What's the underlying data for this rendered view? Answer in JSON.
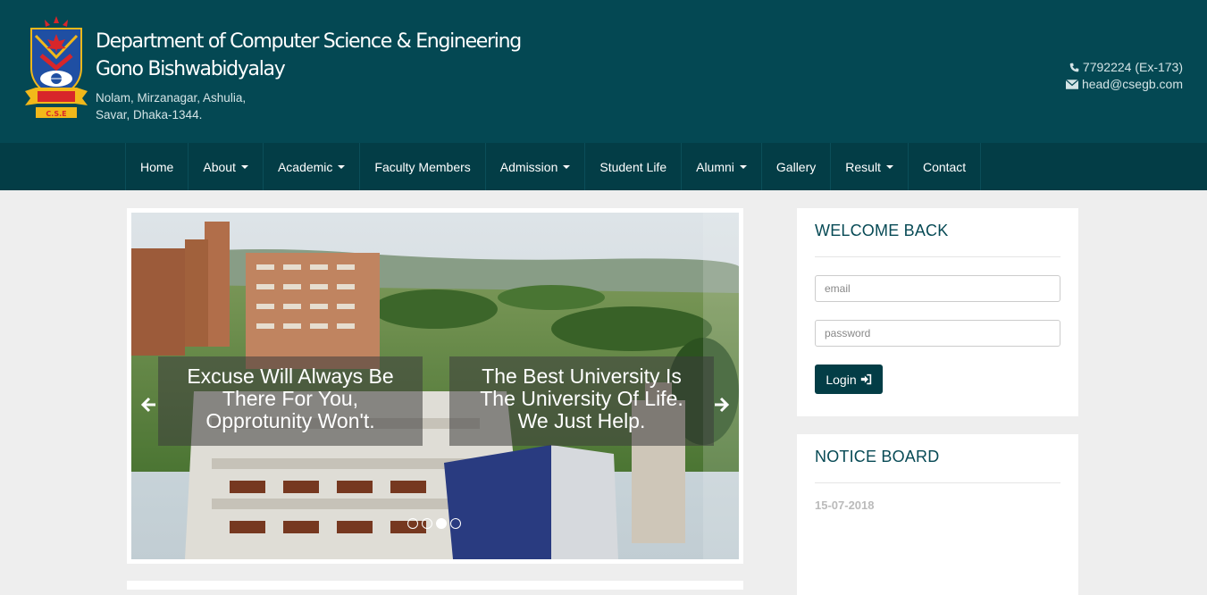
{
  "header": {
    "title_line1": "Department of Computer Science & Engineering",
    "title_line2": "Gono Bishwabidyalay",
    "address_line1": "Nolam, Mirzanagar, Ashulia,",
    "address_line2": "Savar, Dhaka-1344.",
    "phone": "7792224 (Ex-173)",
    "email": "head@csegb.com",
    "logo_text": "C.S.E"
  },
  "nav": {
    "items": [
      {
        "label": "Home",
        "dropdown": false
      },
      {
        "label": "About",
        "dropdown": true
      },
      {
        "label": "Academic",
        "dropdown": true
      },
      {
        "label": "Faculty Members",
        "dropdown": false
      },
      {
        "label": "Admission",
        "dropdown": true
      },
      {
        "label": "Student Life",
        "dropdown": false
      },
      {
        "label": "Alumni",
        "dropdown": true
      },
      {
        "label": "Gallery",
        "dropdown": false
      },
      {
        "label": "Result",
        "dropdown": true
      },
      {
        "label": "Contact",
        "dropdown": false
      }
    ]
  },
  "slider": {
    "captions": [
      {
        "lines": [
          "Excuse Will Always Be",
          "There For You,",
          "Opprotunity Won't."
        ]
      },
      {
        "lines": [
          "The Best University Is",
          "The University Of Life.",
          "We Just Help."
        ]
      }
    ],
    "slide_count": 4,
    "active_slide": 3
  },
  "login": {
    "title": "WELCOME BACK",
    "email_placeholder": "email",
    "password_placeholder": "password",
    "button_label": "Login"
  },
  "notice": {
    "title": "NOTICE BOARD",
    "date": "15-07-2018"
  },
  "colors": {
    "header_bg": "#044853",
    "nav_bg": "#033d46",
    "accent": "#074a55",
    "page_bg": "#eeeeee"
  }
}
